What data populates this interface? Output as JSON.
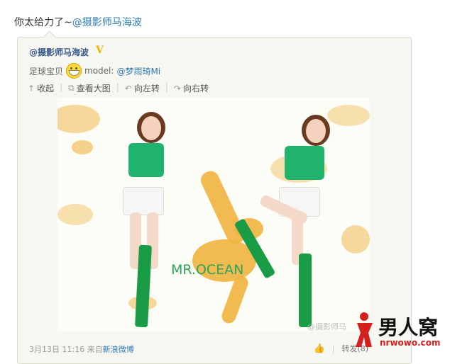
{
  "post": {
    "text_prefix": "你太给力了~",
    "text_mention": "@摄影师马海波"
  },
  "card": {
    "author": "@摄影师马海波",
    "verified_badge": "V",
    "caption_text": "足球宝贝",
    "caption_model_label": "model:",
    "caption_model_mention": "@梦雨琦Mi",
    "actions": [
      {
        "icon": "arrow-up-icon",
        "label": "收起"
      },
      {
        "icon": "external-link-icon",
        "label": "查看大图"
      },
      {
        "icon": "rotate-left-icon",
        "label": "向左转"
      },
      {
        "icon": "rotate-right-icon",
        "label": "向右转"
      }
    ],
    "photo_logo": "MR.OCEAN",
    "photo_credit": "@摄影师马",
    "footer_time": "3月13日 11:16",
    "footer_from": "来自",
    "footer_source": "新浪微博",
    "repost_label": "转发(8)"
  },
  "site": {
    "name": "男人窝",
    "url": "nrwowo.com"
  },
  "colors": {
    "link": "#2f7bb5",
    "card_bg": "#f7f7f2",
    "accent_green": "#20b36e",
    "splash_orange": "#f1b43f",
    "site_red": "#d62020"
  }
}
